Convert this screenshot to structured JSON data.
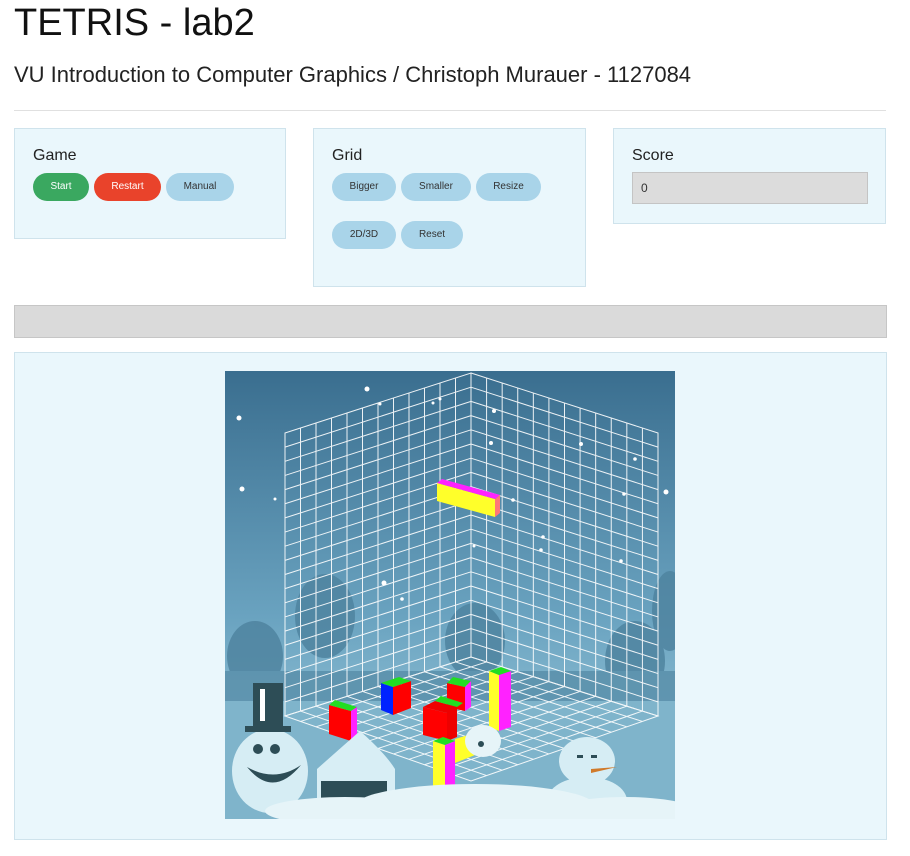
{
  "header": {
    "title": "TETRIS - lab2",
    "subtitle": "VU Introduction to Computer Graphics / Christoph Murauer - 1127084"
  },
  "game_panel": {
    "title": "Game",
    "start_label": "Start",
    "restart_label": "Restart",
    "manual_label": "Manual"
  },
  "grid_panel": {
    "title": "Grid",
    "bigger_label": "Bigger",
    "smaller_label": "Smaller",
    "resize_label": "Resize",
    "toggle_3d_label": "2D/3D",
    "reset_label": "Reset"
  },
  "score_panel": {
    "title": "Score",
    "value": "0"
  },
  "progress": {
    "value": 0
  },
  "colors": {
    "accent_green": "#3aa860",
    "accent_red": "#e9432b",
    "button_blue": "#a9d4e9",
    "panel_bg": "#eaf7fc",
    "scene_sky": "#3b6f8f"
  }
}
